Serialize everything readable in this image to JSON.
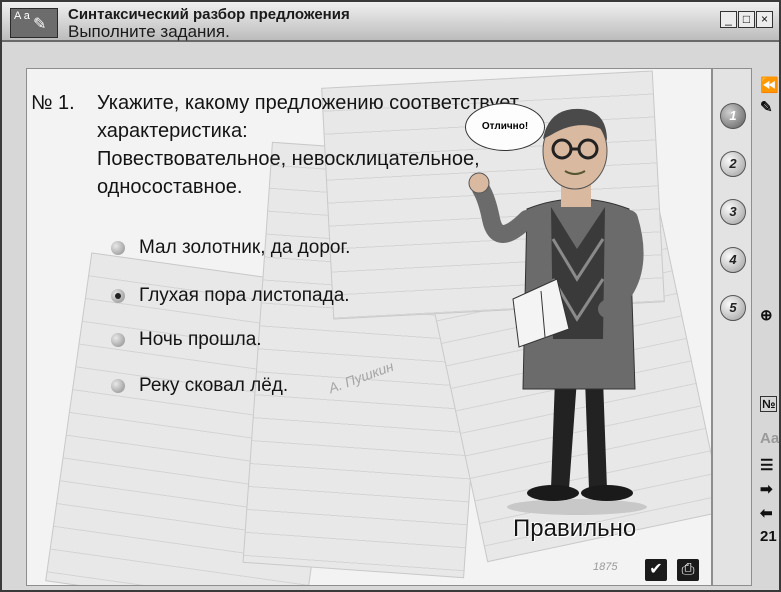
{
  "window": {
    "title": "Синтаксический разбор предложения",
    "subtitle": "Выполните задания.",
    "icon_text": "A a",
    "controls": [
      "minimize",
      "maximize",
      "close"
    ]
  },
  "question": {
    "number": "№ 1.",
    "text": "Укажите, какому предложению соответствует характеристика:\n Повествовательное, невосклицательное, односоставное."
  },
  "options": [
    {
      "label": "Мал золотник, да дорог.",
      "selected": false
    },
    {
      "label": "Глухая пора листопада.",
      "selected": true
    },
    {
      "label": "Ночь прошла.",
      "selected": false
    },
    {
      "label": "Реку сковал лёд.",
      "selected": false
    }
  ],
  "teacher": {
    "speech": "Отлично!"
  },
  "result": {
    "label": "Правильно"
  },
  "bottom_buttons": [
    {
      "name": "check-button",
      "icon": "checkmark-icon"
    },
    {
      "name": "print-button",
      "icon": "printer-icon"
    }
  ],
  "steps": [
    "1",
    "2",
    "3",
    "4",
    "5"
  ],
  "active_step": "1",
  "toolbar": {
    "numbering_label": "№",
    "font_label": "Aa",
    "page_number": "21"
  },
  "decor_text": {
    "sheet_year": "1875",
    "pushkin": "А. Пушкин"
  },
  "colors": {
    "background": "#d7d7d7",
    "content": "#f3f3f3",
    "accent": "#1a1a1a"
  }
}
